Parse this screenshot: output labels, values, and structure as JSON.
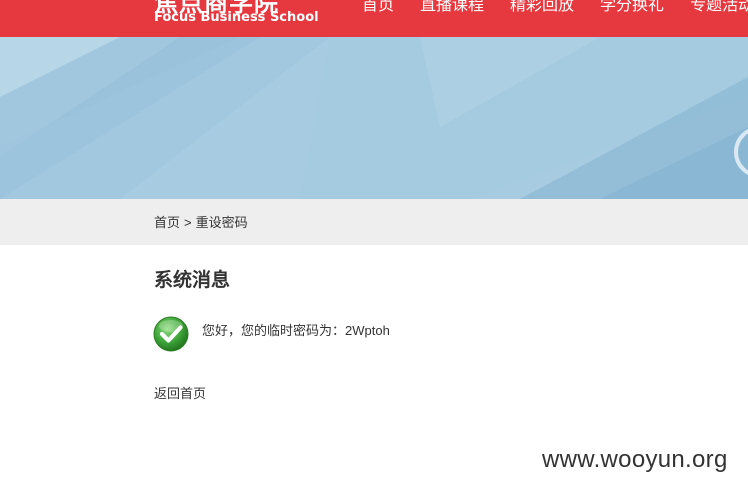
{
  "header": {
    "logo_cn": "焦点商学院",
    "logo_en": "Focus Business School",
    "nav": [
      "首页",
      "直播课程",
      "精彩回放",
      "学分换礼",
      "专题活动"
    ]
  },
  "breadcrumb": {
    "home": "首页",
    "separator": ">",
    "current": "重设密码"
  },
  "message": {
    "title": "系统消息",
    "text": "您好，您的临时密码为：2Wptoh",
    "icon": "check-circle-icon"
  },
  "back_link": "返回首页",
  "watermark": "www.wooyun.org",
  "colors": {
    "header_bg": "#e5383f",
    "banner_bg": "#a9cde2",
    "crumb_bg": "#eeeeee",
    "success_green": "#3fa63a"
  }
}
